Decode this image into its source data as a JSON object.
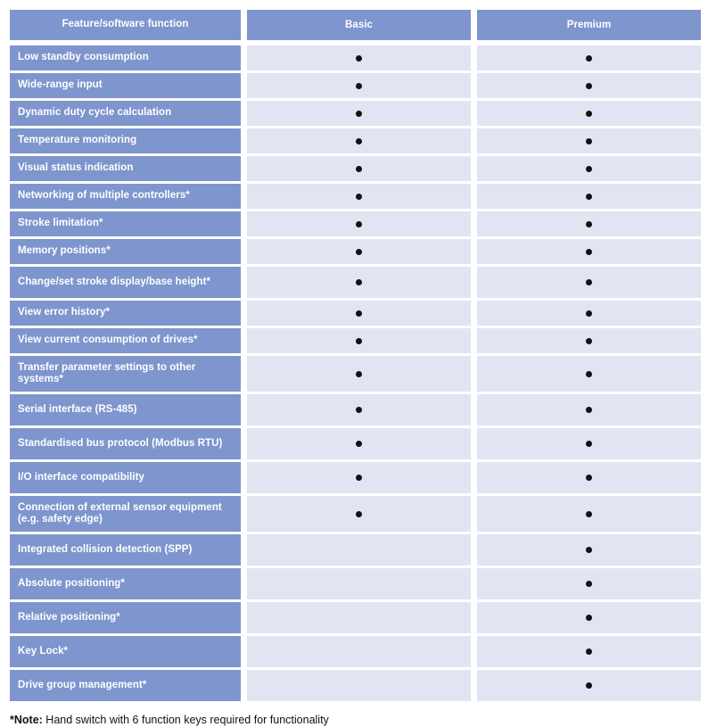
{
  "table": {
    "columns": [
      "Feature/software function",
      "Basic",
      "Premium"
    ],
    "rows": [
      {
        "label": "Low standby consumption",
        "basic": true,
        "premium": true,
        "size": "normal"
      },
      {
        "label": "Wide-range input",
        "basic": true,
        "premium": true,
        "size": "normal"
      },
      {
        "label": "Dynamic duty cycle calculation",
        "basic": true,
        "premium": true,
        "size": "normal"
      },
      {
        "label": "Temperature monitoring",
        "basic": true,
        "premium": true,
        "size": "normal"
      },
      {
        "label": "Visual status indication",
        "basic": true,
        "premium": true,
        "size": "normal"
      },
      {
        "label": "Networking of multiple controllers*",
        "basic": true,
        "premium": true,
        "size": "normal"
      },
      {
        "label": "Stroke limitation*",
        "basic": true,
        "premium": true,
        "size": "normal"
      },
      {
        "label": "Memory positions*",
        "basic": true,
        "premium": true,
        "size": "normal"
      },
      {
        "label": "Change/set stroke display/base height*",
        "basic": true,
        "premium": true,
        "size": "tall"
      },
      {
        "label": "View error history*",
        "basic": true,
        "premium": true,
        "size": "normal"
      },
      {
        "label": "View current consumption of drives*",
        "basic": true,
        "premium": true,
        "size": "normal"
      },
      {
        "label": "Transfer parameter settings to other systems*",
        "basic": true,
        "premium": true,
        "size": "xtall"
      },
      {
        "label": "Serial interface (RS-485)",
        "basic": true,
        "premium": true,
        "size": "tall"
      },
      {
        "label": "Standardised bus protocol (Modbus RTU)",
        "basic": true,
        "premium": true,
        "size": "tall"
      },
      {
        "label": "I/O interface compatibility",
        "basic": true,
        "premium": true,
        "size": "tall"
      },
      {
        "label": "Connection of external sensor equipment (e.g. safety edge)",
        "basic": true,
        "premium": true,
        "size": "xtall"
      },
      {
        "label": "Integrated collision detection (SPP)",
        "basic": false,
        "premium": true,
        "size": "tall"
      },
      {
        "label": "Absolute positioning*",
        "basic": false,
        "premium": true,
        "size": "tall"
      },
      {
        "label": "Relative positioning*",
        "basic": false,
        "premium": true,
        "size": "tall"
      },
      {
        "label": "Key Lock*",
        "basic": false,
        "premium": true,
        "size": "tall"
      },
      {
        "label": "Drive group management*",
        "basic": false,
        "premium": true,
        "size": "tall"
      }
    ]
  },
  "footnote": {
    "marker": "*Note:",
    "text": " Hand switch with 6 function keys required for functionality"
  },
  "colors": {
    "header_blue": "#7e95cd",
    "cell_lavender": "#e2e5f1",
    "dot": "#111111",
    "page_background": "#ffffff"
  }
}
